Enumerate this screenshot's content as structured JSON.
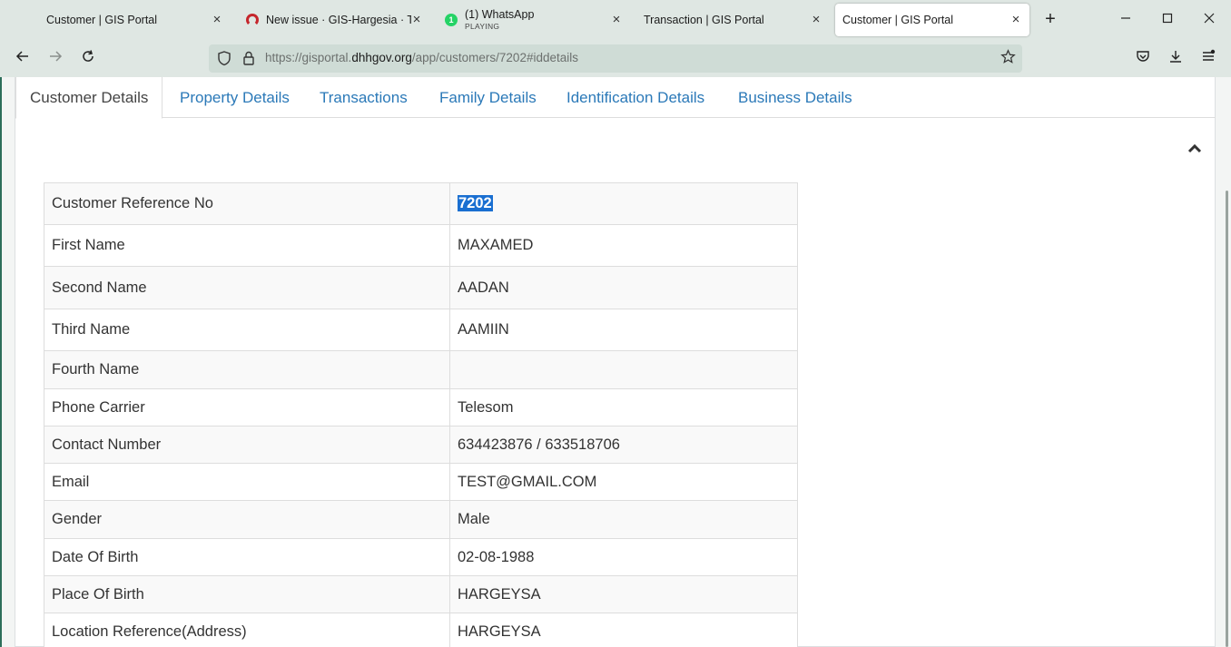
{
  "browser": {
    "tabs": [
      {
        "title": "Customer | GIS Portal",
        "subtitle": ""
      },
      {
        "title": "New issue · GIS-Hargesia · Team",
        "subtitle": ""
      },
      {
        "title": "(1) WhatsApp",
        "subtitle": "PLAYING",
        "badge": "1"
      },
      {
        "title": "Transaction | GIS Portal",
        "subtitle": ""
      },
      {
        "title": "Customer | GIS Portal",
        "subtitle": ""
      }
    ],
    "close_glyph": "×",
    "new_tab_glyph": "+",
    "url_prefix": "https://gisportal.",
    "url_domain": "dhhgov.org",
    "url_path": "/app/customers/7202#iddetails"
  },
  "page_tabs": [
    "Customer Details",
    "Property Details",
    "Transactions",
    "Family Details",
    "Identification Details",
    "Business Details"
  ],
  "details": [
    {
      "label": "Customer Reference No",
      "value": "7202"
    },
    {
      "label": "First Name",
      "value": "MAXAMED"
    },
    {
      "label": "Second Name",
      "value": "AADAN"
    },
    {
      "label": "Third Name",
      "value": "AAMIIN"
    },
    {
      "label": "Fourth Name",
      "value": ""
    },
    {
      "label": "Phone Carrier",
      "value": "Telesom"
    },
    {
      "label": "Contact Number",
      "value": "634423876 / 633518706"
    },
    {
      "label": "Email",
      "value": "TEST@GMAIL.COM"
    },
    {
      "label": "Gender",
      "value": "Male"
    },
    {
      "label": "Date Of Birth",
      "value": "02-08-1988"
    },
    {
      "label": "Place Of Birth",
      "value": "HARGEYSA"
    },
    {
      "label": "Location Reference(Address)",
      "value": "HARGEYSA"
    }
  ],
  "icons": {
    "back": "arrow-left-icon",
    "forward": "arrow-right-icon",
    "reload": "reload-icon",
    "shield": "shield-icon",
    "lock": "lock-icon",
    "star": "star-icon",
    "pocket": "pocket-icon",
    "download": "download-icon",
    "menu": "menu-icon",
    "collapse": "chevron-up-icon"
  },
  "colors": {
    "link": "#2b79b8",
    "selection": "#1a6fd1",
    "chrome": "#dfe7e3"
  }
}
